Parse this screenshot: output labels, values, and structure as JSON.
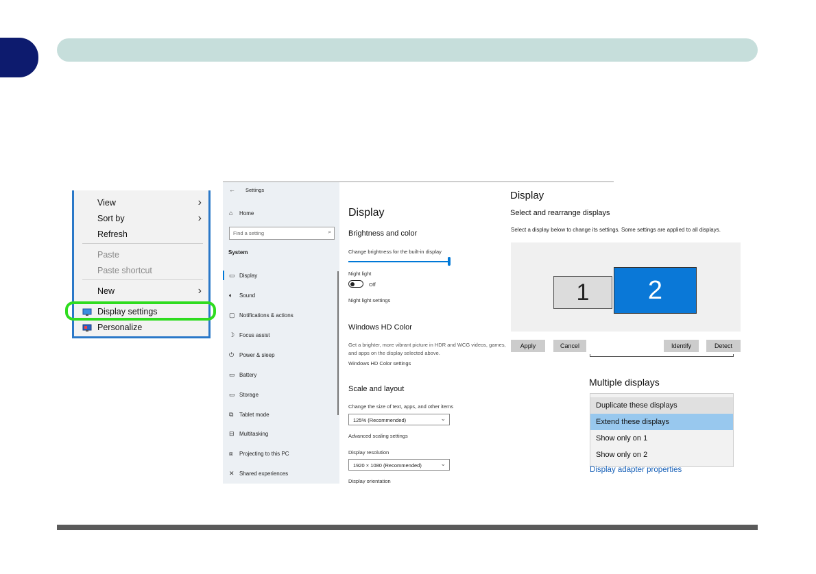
{
  "page": {
    "chapter_tab_color": "#0d1b6e",
    "header_color": "#c6dedb"
  },
  "context_menu": {
    "items": [
      {
        "label": "View",
        "has_submenu": true,
        "enabled": true
      },
      {
        "label": "Sort by",
        "has_submenu": true,
        "enabled": true
      },
      {
        "label": "Refresh",
        "has_submenu": false,
        "enabled": true
      },
      {
        "label": "Paste",
        "has_submenu": false,
        "enabled": false
      },
      {
        "label": "Paste shortcut",
        "has_submenu": false,
        "enabled": false
      },
      {
        "label": "New",
        "has_submenu": true,
        "enabled": true
      },
      {
        "label": "Display settings",
        "has_submenu": false,
        "enabled": true,
        "highlighted": true
      },
      {
        "label": "Personalize",
        "has_submenu": false,
        "enabled": true
      }
    ],
    "highlight_color": "#2fdc1f"
  },
  "settings": {
    "window_title": "Settings",
    "back_icon": "back-arrow-icon",
    "sidebar": {
      "home": "Home",
      "search_placeholder": "Find a setting",
      "section": "System",
      "items": [
        {
          "label": "Display",
          "icon": "monitor-icon",
          "active": true
        },
        {
          "label": "Sound",
          "icon": "speaker-icon"
        },
        {
          "label": "Notifications & actions",
          "icon": "notification-icon"
        },
        {
          "label": "Focus assist",
          "icon": "moon-icon"
        },
        {
          "label": "Power & sleep",
          "icon": "power-icon"
        },
        {
          "label": "Battery",
          "icon": "battery-icon"
        },
        {
          "label": "Storage",
          "icon": "storage-icon"
        },
        {
          "label": "Tablet mode",
          "icon": "tablet-icon"
        },
        {
          "label": "Multitasking",
          "icon": "multitasking-icon"
        },
        {
          "label": "Projecting to this PC",
          "icon": "projecting-icon"
        },
        {
          "label": "Shared experiences",
          "icon": "shared-icon"
        }
      ]
    },
    "main": {
      "title": "Display",
      "brightness_heading": "Brightness and color",
      "brightness_label": "Change brightness for the built-in display",
      "brightness_level": 1.0,
      "night_light_label": "Night light",
      "night_light_state": "Off",
      "night_light_link": "Night light settings",
      "hd_color_heading": "Windows HD Color",
      "hd_color_desc_1": "Get a brighter, more vibrant picture in HDR and WCG videos, games,",
      "hd_color_desc_2": "and apps on the display selected above.",
      "hd_color_link": "Windows HD Color settings",
      "scale_heading": "Scale and layout",
      "scale_label": "Change the size of text, apps, and other items",
      "scale_value": "125% (Recommended)",
      "advanced_scaling_link": "Advanced scaling settings",
      "resolution_label": "Display resolution",
      "resolution_value": "1920 × 1080 (Recommended)",
      "orientation_label": "Display orientation"
    }
  },
  "display_panel": {
    "title": "Display",
    "subtitle": "Select and rearrange displays",
    "description": "Select a display below to change its settings. Some settings are applied to all displays.",
    "monitor_1": "1",
    "monitor_2": "2",
    "selected_color": "#0a78d7",
    "buttons": {
      "apply": "Apply",
      "cancel": "Cancel",
      "identify": "Identify",
      "detect": "Detect"
    }
  },
  "multiple_displays": {
    "heading": "Multiple displays",
    "options": [
      {
        "label": "Duplicate these displays",
        "state": "hover"
      },
      {
        "label": "Extend these displays",
        "state": "selected"
      },
      {
        "label": "Show only on 1",
        "state": "normal"
      },
      {
        "label": "Show only on 2",
        "state": "normal"
      }
    ],
    "adapter_link": "Display adapter properties"
  }
}
